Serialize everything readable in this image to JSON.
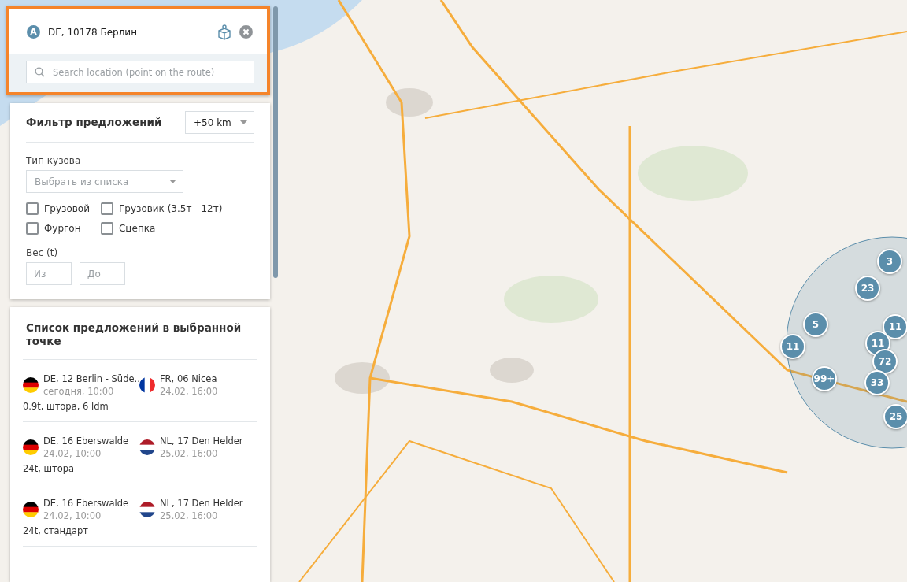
{
  "route_point": {
    "badge": "A",
    "address": "DE, 10178 Берлин",
    "search": {
      "placeholder": "Search location (point on the route)"
    }
  },
  "filter": {
    "title": "Фильтр предложений",
    "radius": "+50 km",
    "body_type": {
      "label": "Тип кузова",
      "placeholder": "Выбрать из списка"
    },
    "checkboxes": [
      {
        "label": "Грузовой",
        "checked": false
      },
      {
        "label": "Грузовик (3.5т - 12т)",
        "checked": false
      },
      {
        "label": "Фургон",
        "checked": false
      },
      {
        "label": "Сцепка",
        "checked": false
      }
    ],
    "weight": {
      "label": "Вес (t)",
      "from": {
        "placeholder": "Из"
      },
      "to": {
        "placeholder": "До"
      }
    }
  },
  "offers": {
    "title": "Список предложений в выбранной точке",
    "items": [
      {
        "from": {
          "kind": "de",
          "place": "DE, 12 Berlin - Süde...",
          "time": "сегодня, 10:00"
        },
        "to": {
          "kind": "fr",
          "place": "FR, 06 Nicea",
          "time": "24.02, 16:00"
        },
        "details": "0.9t, штора, 6 ldm"
      },
      {
        "from": {
          "kind": "de",
          "place": "DE, 16 Eberswalde",
          "time": "24.02, 10:00"
        },
        "to": {
          "kind": "nl",
          "place": "NL, 17 Den Helder",
          "time": "25.02, 16:00"
        },
        "details": "24t, штора"
      },
      {
        "from": {
          "kind": "de",
          "place": "DE, 16 Eberswalde",
          "time": "24.02, 10:00"
        },
        "to": {
          "kind": "nl",
          "place": "NL, 17 Den Helder",
          "time": "25.02, 16:00"
        },
        "details": "24t, стандарт"
      }
    ]
  },
  "clusters": [
    {
      "count": "3"
    },
    {
      "count": "23"
    },
    {
      "count": "5"
    },
    {
      "count": "11"
    },
    {
      "count": "11"
    },
    {
      "count": "11"
    },
    {
      "count": "72"
    },
    {
      "count": "99+"
    },
    {
      "count": "33"
    },
    {
      "count": "25"
    }
  ]
}
